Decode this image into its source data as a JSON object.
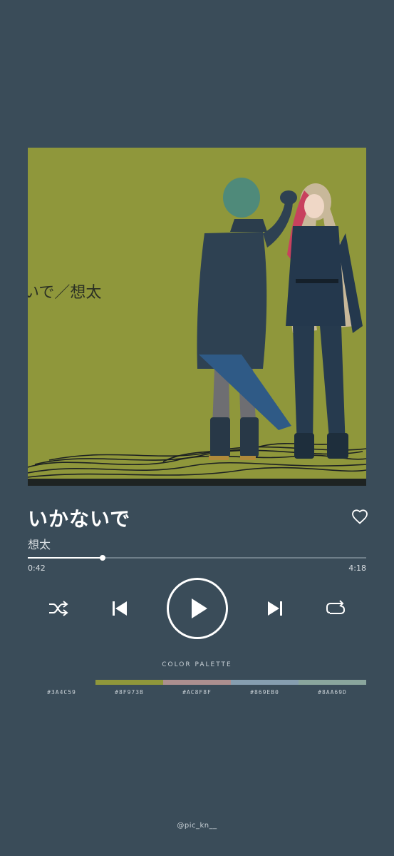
{
  "track": {
    "title": "いかないで",
    "artist": "想太",
    "elapsed": "0:42",
    "total": "4:18",
    "progress": 0.22
  },
  "artwork": {
    "caption": "いで／想太",
    "background": "#8F973B"
  },
  "controls": {
    "like": "heart-icon",
    "shuffle": "shuffle-icon",
    "previous": "skip-previous-icon",
    "play": "play-icon",
    "next": "skip-next-icon",
    "repeat": "repeat-icon"
  },
  "palette": {
    "label": "COLOR PALETTE",
    "colors": [
      {
        "code": "#3A4C59",
        "hex": "#3A4C59"
      },
      {
        "code": "#8F973B",
        "hex": "#8F973B"
      },
      {
        "code": "#AC8F8F",
        "hex": "#AC8F8F"
      },
      {
        "code": "#869EB0",
        "hex": "#869EB0"
      },
      {
        "code": "#8AA69D",
        "hex": "#8AA69D"
      }
    ]
  },
  "credit": {
    "handle": "@pic_kn__"
  }
}
